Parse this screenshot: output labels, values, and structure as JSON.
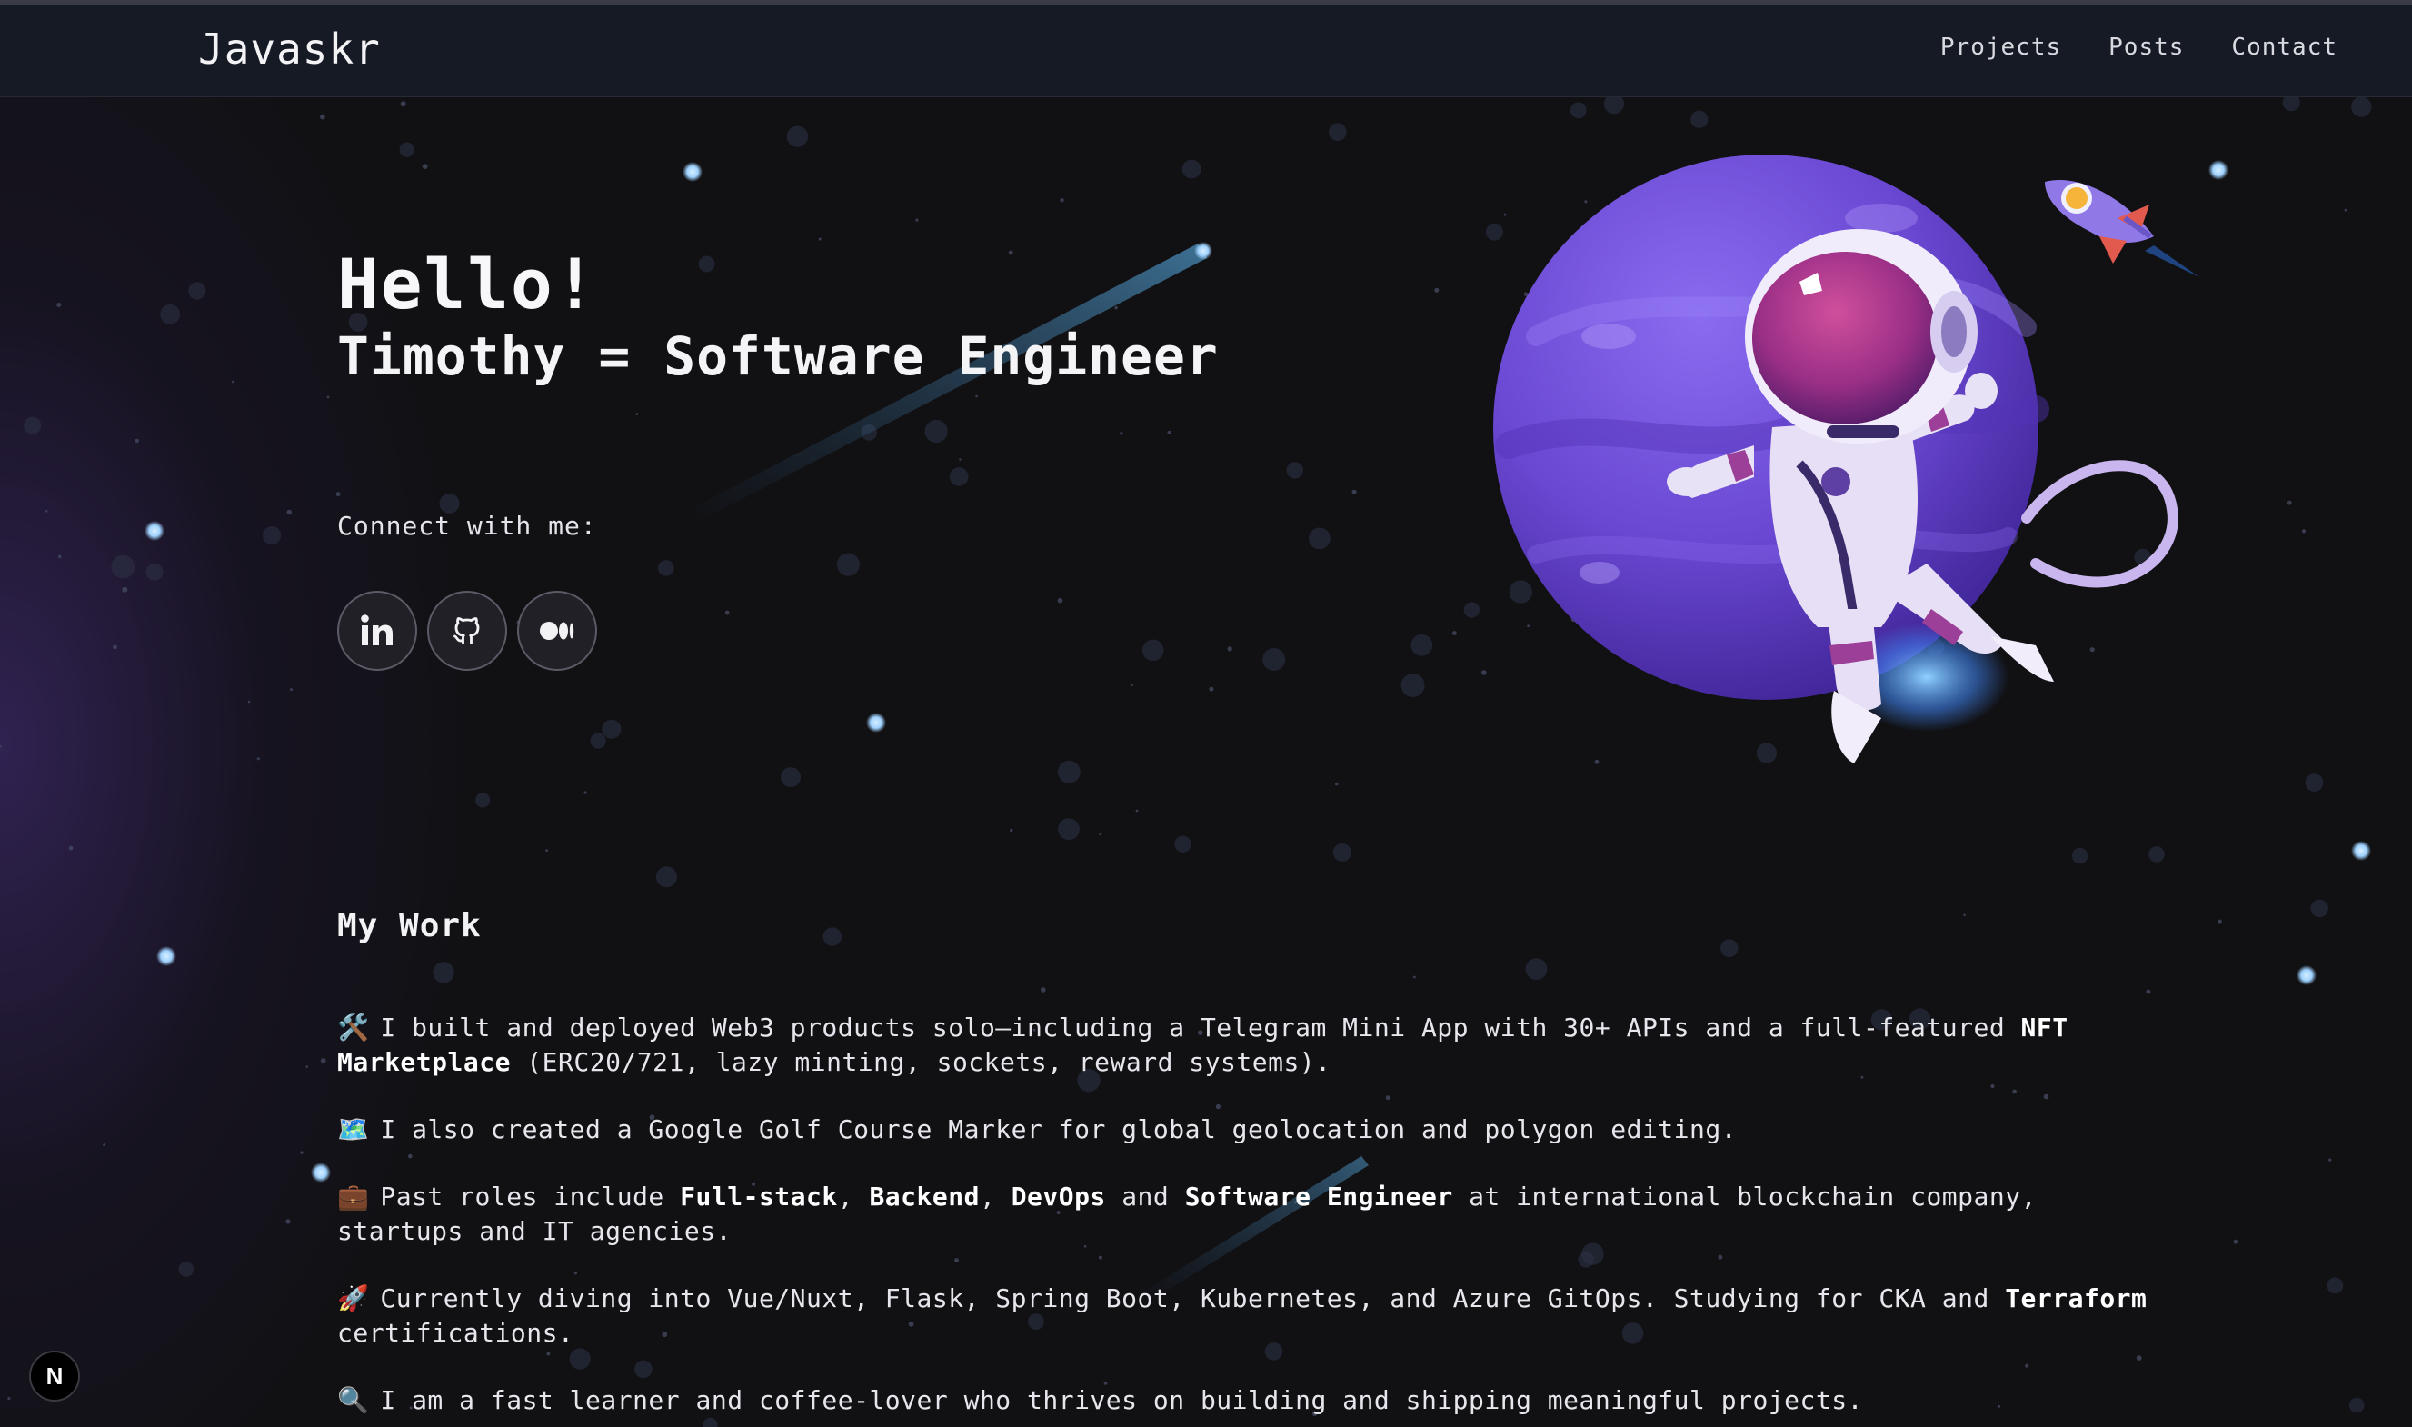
{
  "navbar": {
    "brand": "Javaskr",
    "links": [
      {
        "label": "Projects"
      },
      {
        "label": "Posts"
      },
      {
        "label": "Contact"
      }
    ]
  },
  "hero": {
    "greeting": "Hello!",
    "headline": "Timothy = Software Engineer",
    "connect_label": "Connect with me:",
    "socials": [
      {
        "icon": "linkedin-icon"
      },
      {
        "icon": "github-icon"
      },
      {
        "icon": "medium-icon"
      }
    ]
  },
  "work": {
    "title": "My Work",
    "items": [
      {
        "emoji": "🛠️",
        "segments": [
          {
            "text": "I built and deployed Web3 products solo—including a Telegram Mini App with 30+ APIs and a full-featured "
          },
          {
            "text": "NFT Marketplace",
            "bold": true
          },
          {
            "text": " (ERC20/721, lazy minting, sockets, reward systems)."
          }
        ]
      },
      {
        "emoji": "🗺️",
        "segments": [
          {
            "text": "I also created a Google Golf Course Marker for global geolocation and polygon editing."
          }
        ]
      },
      {
        "emoji": "💼",
        "segments": [
          {
            "text": "Past roles include "
          },
          {
            "text": "Full-stack",
            "bold": true
          },
          {
            "text": ", "
          },
          {
            "text": "Backend",
            "bold": true
          },
          {
            "text": ", "
          },
          {
            "text": "DevOps",
            "bold": true
          },
          {
            "text": " and "
          },
          {
            "text": "Software Engineer",
            "bold": true
          },
          {
            "text": " at international blockchain company, startups and IT agencies."
          }
        ]
      },
      {
        "emoji": "🚀",
        "segments": [
          {
            "text": "Currently diving into Vue/Nuxt, Flask, Spring Boot, Kubernetes, and Azure GitOps. Studying for CKA and "
          },
          {
            "text": "Terraform",
            "bold": true
          },
          {
            "text": " certifications."
          }
        ]
      },
      {
        "emoji": "🔍",
        "segments": [
          {
            "text": "I am a fast learner and coffee-lover who thrives on building and shipping meaningful projects."
          }
        ]
      }
    ]
  },
  "badge": {
    "label": "N"
  },
  "colors": {
    "background": "#111114",
    "navbar": "#161a25",
    "planet": "#6b4fd0",
    "star": "#a9d8ff"
  }
}
